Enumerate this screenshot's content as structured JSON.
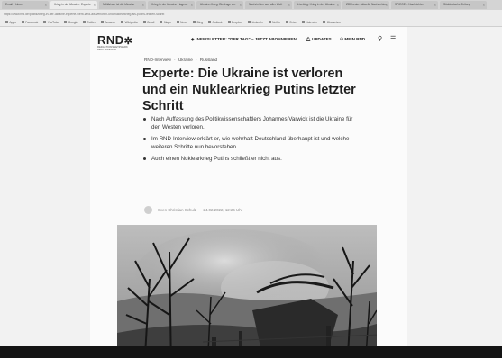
{
  "browser": {
    "tabs": [
      {
        "label": "Email · Inbox"
      },
      {
        "label": "Krieg in der Ukraine: Experte"
      },
      {
        "label": "Militärisch ist die Ukraine"
      },
      {
        "label": "Krieg in der Ukraine | tagess"
      },
      {
        "label": "Ukraine-Krieg: Die Lage am"
      },
      {
        "label": "Nachrichten aus aller Welt"
      },
      {
        "label": "Liveblog: Krieg in der Ukraine"
      },
      {
        "label": "ZDFheute: Aktuelle Nachrichten"
      },
      {
        "label": "SPIEGEL: Nachrichten"
      },
      {
        "label": "Süddeutsche Zeitung"
      }
    ],
    "url": "https://www.rnd.de/politik/krieg-in-der-ukraine-experte-sieht-land-als-verloren-und-nuklearkrieg-als-putins-letzten-schritt",
    "bookmarks": [
      "Apps",
      "Facebook",
      "YouTube",
      "Google",
      "Twitter",
      "Amazon",
      "Wikipedia",
      "Gmail",
      "Maps",
      "News",
      "Bing",
      "Outlook",
      "Dropbox",
      "LinkedIn",
      "Netflix",
      "Drive",
      "Kalender",
      "Übersetzer"
    ]
  },
  "site": {
    "logo": "RND",
    "logo_sub": "REDAKTIONSNETZWERK DEUTSCHLAND",
    "nav": {
      "newsletter": "NEWSLETTER: \"DER TAG\" – JETZT ABONNIEREN",
      "updates": "UPDATES",
      "mein_rnd": "MEIN RND"
    }
  },
  "article": {
    "breadcrumb": [
      "RND-Interview",
      "Ukraine",
      "Russland"
    ],
    "headline": "Experte: Die Ukraine ist verloren und ein Nuklearkrieg Putins letzter Schritt",
    "bullets": [
      "Nach Auffassung des Politikwissenschaftlers Johannes Varwick ist die Ukraine für den Westen verloren.",
      "Im RND-Interview erklärt er, wie wehrhaft Deutschland überhaupt ist und welche weiteren Schritte nun bevorstehen.",
      "Auch einen Nuklearkrieg Putins schließt er nicht aus."
    ],
    "author": "Sven Christian Schulz",
    "date": "24.02.2022, 12:26 Uhr"
  },
  "icons": {
    "newsletter": "mail-diamond-icon",
    "updates": "bell-icon",
    "mein_rnd": "user-icon",
    "search": "search-icon",
    "menu": "hamburger-menu-icon",
    "download": "download-icon"
  }
}
